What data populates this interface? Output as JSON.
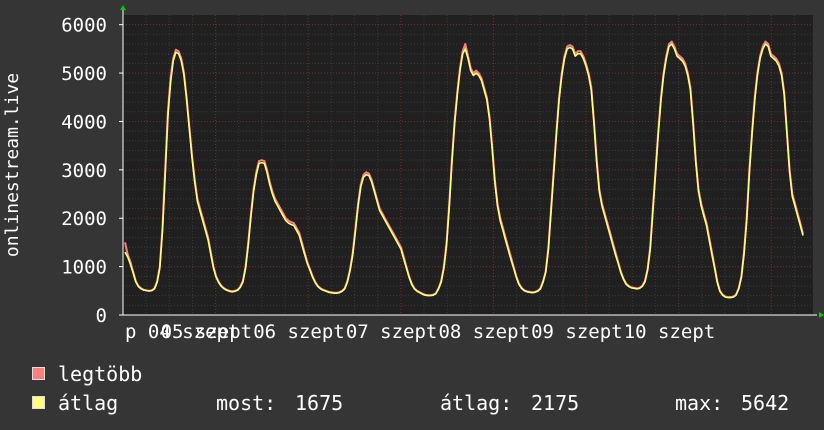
{
  "chart_data": {
    "type": "line",
    "ylabel": "onlinestream.live",
    "ylim": [
      0,
      6200
    ],
    "yticks": [
      0,
      1000,
      2000,
      3000,
      4000,
      5000,
      6000
    ],
    "x_tick_labels": [
      "p 04 szept",
      "05 szept",
      "06 szept",
      "07 szept",
      "08 szept",
      "09 szept",
      "10 szept"
    ],
    "days": 7.45,
    "series": [
      {
        "name": "legtöbb",
        "color": "#ff7f7f",
        "values": [
          1500,
          1250,
          1100,
          900,
          700,
          600,
          550,
          520,
          510,
          500,
          510,
          550,
          700,
          1000,
          1800,
          3000,
          4200,
          4900,
          5300,
          5480,
          5450,
          5300,
          5000,
          4500,
          3900,
          3300,
          2800,
          2400,
          2200,
          2000,
          1800,
          1600,
          1300,
          1000,
          800,
          680,
          600,
          550,
          520,
          500,
          490,
          500,
          520,
          580,
          700,
          1000,
          1500,
          2100,
          2600,
          2950,
          3180,
          3200,
          3180,
          3000,
          2750,
          2550,
          2400,
          2300,
          2200,
          2100,
          2000,
          1950,
          1920,
          1900,
          1800,
          1700,
          1500,
          1300,
          1100,
          950,
          800,
          680,
          600,
          550,
          520,
          500,
          480,
          470,
          460,
          460,
          470,
          500,
          550,
          700,
          950,
          1300,
          1800,
          2300,
          2700,
          2900,
          2950,
          2920,
          2800,
          2600,
          2400,
          2200,
          2100,
          2000,
          1900,
          1800,
          1700,
          1600,
          1500,
          1400,
          1200,
          1000,
          800,
          650,
          550,
          500,
          470,
          440,
          420,
          410,
          410,
          420,
          450,
          550,
          700,
          1000,
          1500,
          2300,
          3200,
          4000,
          4600,
          5100,
          5450,
          5600,
          5350,
          5100,
          5000,
          5050,
          5000,
          4900,
          4700,
          4500,
          4100,
          3500,
          2800,
          2300,
          2000,
          1800,
          1600,
          1400,
          1200,
          1000,
          800,
          650,
          560,
          510,
          490,
          480,
          470,
          480,
          500,
          550,
          700,
          900,
          1400,
          2200,
          3000,
          3800,
          4500,
          5000,
          5350,
          5550,
          5580,
          5550,
          5400,
          5450,
          5450,
          5350,
          5200,
          5000,
          4700,
          4000,
          3200,
          2600,
          2300,
          2100,
          1900,
          1700,
          1500,
          1300,
          1100,
          900,
          750,
          650,
          600,
          570,
          560,
          550,
          560,
          600,
          700,
          950,
          1400,
          2200,
          3000,
          3800,
          4500,
          5000,
          5350,
          5600,
          5650,
          5550,
          5400,
          5350,
          5300,
          5200,
          5000,
          4700,
          4000,
          3200,
          2600,
          2300,
          2100,
          1900,
          1600,
          1300,
          1000,
          700,
          500,
          420,
          380,
          370,
          370,
          380,
          420,
          550,
          800,
          1300,
          2000,
          3000,
          3800,
          4500,
          5000,
          5350,
          5550,
          5650,
          5600,
          5400,
          5350,
          5300,
          5200,
          5000,
          4600,
          3800,
          3000,
          2500,
          2300,
          2100,
          1900,
          1675
        ]
      },
      {
        "name": "átlag",
        "color": "#ffff7f",
        "values": [
          1300,
          1200,
          1050,
          880,
          690,
          590,
          540,
          515,
          505,
          495,
          505,
          540,
          680,
          970,
          1750,
          2900,
          4100,
          4800,
          5250,
          5430,
          5400,
          5250,
          4950,
          4450,
          3850,
          3250,
          2750,
          2350,
          2150,
          1950,
          1750,
          1550,
          1250,
          980,
          780,
          665,
          590,
          540,
          510,
          490,
          480,
          490,
          510,
          570,
          680,
          970,
          1450,
          2050,
          2550,
          2900,
          3130,
          3150,
          3130,
          2950,
          2700,
          2500,
          2350,
          2250,
          2150,
          2050,
          1950,
          1900,
          1870,
          1850,
          1750,
          1650,
          1450,
          1260,
          1070,
          930,
          780,
          665,
          590,
          540,
          510,
          490,
          470,
          460,
          450,
          450,
          460,
          490,
          540,
          680,
          920,
          1250,
          1750,
          2250,
          2650,
          2850,
          2900,
          2880,
          2760,
          2560,
          2360,
          2160,
          2060,
          1960,
          1860,
          1760,
          1660,
          1560,
          1460,
          1360,
          1160,
          970,
          780,
          635,
          540,
          490,
          460,
          430,
          410,
          400,
          400,
          410,
          440,
          540,
          680,
          970,
          1450,
          2250,
          3150,
          3950,
          4550,
          5050,
          5400,
          5500,
          5300,
          5050,
          4950,
          5000,
          4950,
          4850,
          4650,
          4450,
          4050,
          3450,
          2750,
          2250,
          1950,
          1750,
          1550,
          1350,
          1150,
          970,
          780,
          635,
          550,
          500,
          480,
          470,
          460,
          470,
          490,
          540,
          680,
          880,
          1350,
          2150,
          2950,
          3750,
          4450,
          4950,
          5300,
          5500,
          5530,
          5500,
          5350,
          5400,
          5400,
          5300,
          5150,
          4950,
          4650,
          3950,
          3150,
          2550,
          2250,
          2050,
          1850,
          1650,
          1450,
          1250,
          1070,
          880,
          735,
          635,
          590,
          560,
          550,
          540,
          550,
          590,
          680,
          920,
          1350,
          2150,
          2950,
          3750,
          4450,
          4950,
          5300,
          5550,
          5600,
          5500,
          5350,
          5300,
          5250,
          5150,
          4950,
          4650,
          3950,
          3150,
          2550,
          2250,
          2050,
          1850,
          1550,
          1250,
          970,
          680,
          490,
          410,
          370,
          360,
          360,
          370,
          410,
          540,
          780,
          1250,
          1950,
          2950,
          3750,
          4450,
          4950,
          5300,
          5500,
          5600,
          5550,
          5350,
          5300,
          5250,
          5150,
          4950,
          4550,
          3750,
          2950,
          2450,
          2250,
          2050,
          1850,
          1640
        ]
      }
    ],
    "grid": true
  },
  "legend": {
    "items": [
      {
        "label": "legtöbb",
        "color": "#ff7f7f"
      },
      {
        "label": "átlag",
        "color": "#ffff7f"
      }
    ],
    "stats": {
      "most_label": "most:",
      "most_value": "1675",
      "avg_label": "átlag:",
      "avg_value": "2175",
      "max_label": "max:",
      "max_value": "5642"
    }
  }
}
